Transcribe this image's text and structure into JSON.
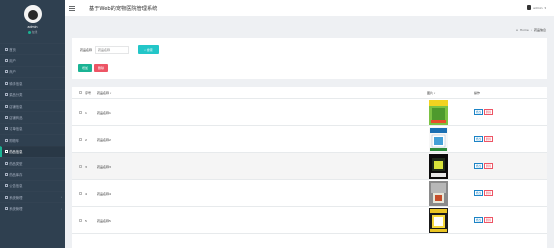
{
  "user": {
    "name": "admin",
    "status": "在线"
  },
  "sidebar": {
    "items": [
      {
        "label": "首页",
        "active": false
      },
      {
        "label": "用户",
        "active": false
      },
      {
        "label": "商户",
        "active": false
      },
      {
        "label": "骑手信息",
        "active": false
      },
      {
        "label": "菜品分类",
        "active": false
      },
      {
        "label": "店铺信息",
        "active": false
      },
      {
        "label": "店铺商品",
        "active": false
      },
      {
        "label": "订单信息",
        "active": false
      },
      {
        "label": "购物车",
        "active": false
      },
      {
        "label": "药品信息",
        "active": true
      },
      {
        "label": "药品类型",
        "active": false
      },
      {
        "label": "药品库存",
        "active": false
      },
      {
        "label": "公告信息",
        "active": false
      },
      {
        "label": "系统管理",
        "active": false,
        "has_children": true
      },
      {
        "label": "系统管理",
        "active": false,
        "has_children": true
      }
    ]
  },
  "topbar": {
    "title": "基于Web的宠物医院管理系统",
    "username": "admin"
  },
  "breadcrumb": {
    "home": "Home",
    "current": "药品信息"
  },
  "search": {
    "label": "药品名称",
    "placeholder": "药品名称",
    "button_label": "搜索"
  },
  "actions": {
    "add_label": "增加",
    "delete_label": "删除"
  },
  "table": {
    "headers": {
      "index": "序号",
      "name": "药品名称",
      "image": "图片",
      "operation": "操作"
    },
    "rows": [
      {
        "index": "1",
        "name": "药品名称1"
      },
      {
        "index": "2",
        "name": "药品名称2"
      },
      {
        "index": "3",
        "name": "药品名称3"
      },
      {
        "index": "4",
        "name": "药品名称4"
      },
      {
        "index": "5",
        "name": "药品名称5"
      }
    ],
    "edit_label": "修改",
    "delete_label": "删除"
  },
  "colors": {
    "sidebar_bg": "#2f4050",
    "accent_green": "#1ab394",
    "search_cyan": "#23c6c8",
    "danger_red": "#ed5565",
    "edit_blue": "#1c84c6"
  }
}
